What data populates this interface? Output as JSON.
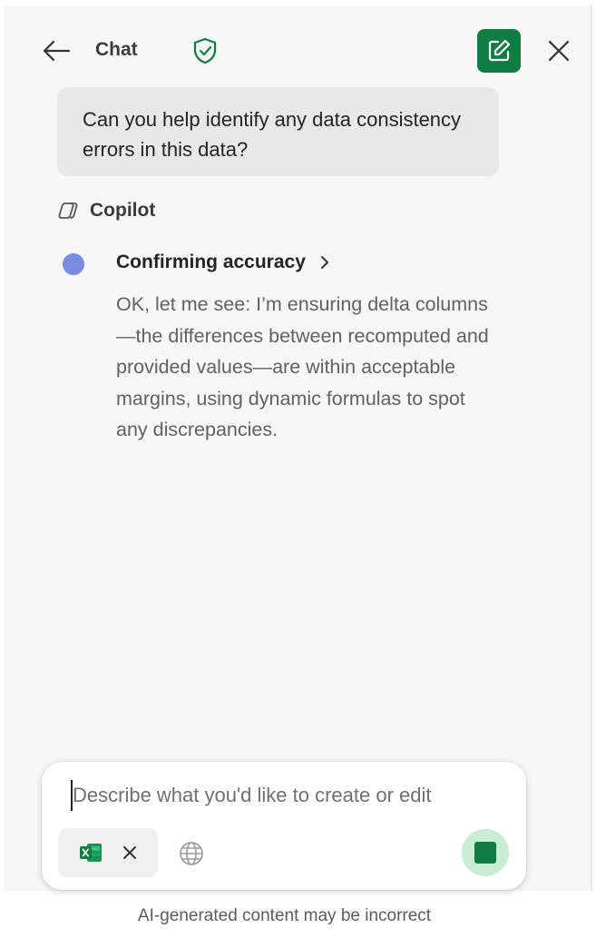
{
  "header": {
    "title": "Chat",
    "back_icon": "arrow-left-icon",
    "privacy_icon": "shield-check-icon",
    "new_chat_icon": "compose-icon",
    "close_icon": "close-icon"
  },
  "conversation": {
    "user_message": "Can you help identify any data consistency errors in this data?",
    "assistant_name": "Copilot",
    "reasoning": {
      "title": "Confirming accuracy",
      "text": "OK, let me see: I’m ensuring delta columns—the differences between recomputed and provided values—are within acceptable margins, using dynamic formulas to spot any discrepancies."
    }
  },
  "composer": {
    "placeholder": "Describe what you'd like to create or edit",
    "value": "",
    "attachment_icon": "excel-icon",
    "web_icon": "globe-icon",
    "stop_icon": "stop-icon"
  },
  "footer": {
    "disclaimer": "AI-generated content may be incorrect"
  },
  "colors": {
    "accent": "#107c41",
    "stop_bg": "#c9ecd4",
    "status_dot": "#7b8bdf",
    "panel_bg": "#f7f7f7",
    "bubble_bg": "#e8e8e8"
  }
}
